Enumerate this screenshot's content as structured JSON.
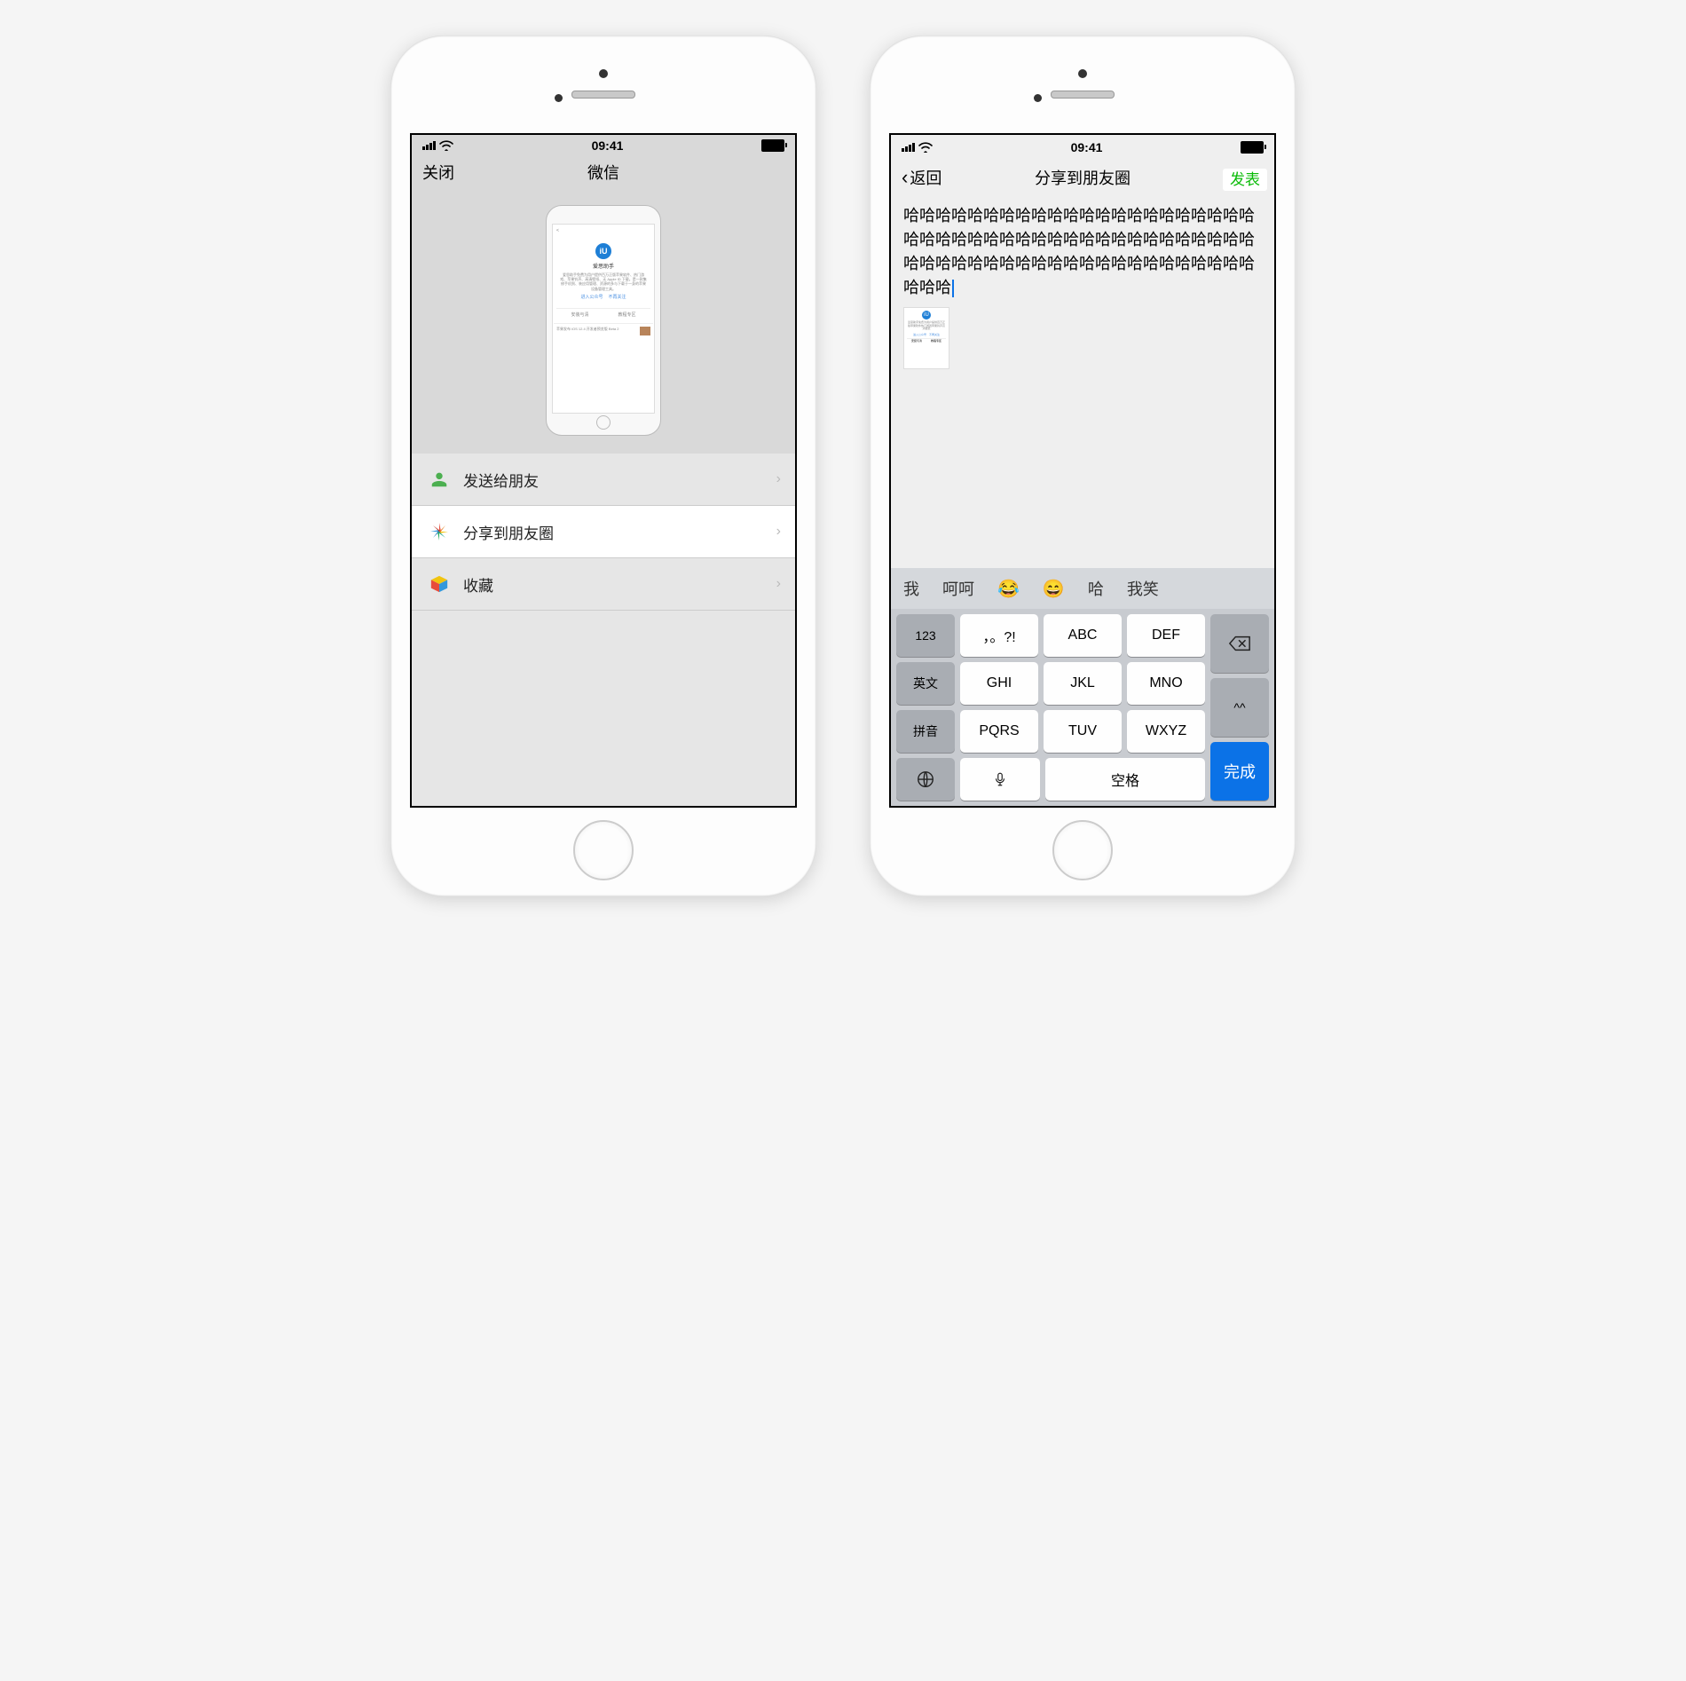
{
  "status_time": "09:41",
  "phone1": {
    "nav_close": "关闭",
    "nav_title": "微信",
    "preview_app": "爱思助手",
    "preview_btn_left": "进入公众号",
    "preview_btn_right": "不再关注",
    "preview_tab_left": "安装与清",
    "preview_tab_right": "教程专区",
    "preview_news": "苹果发布 iOS 12.4 开发者预览版 Beta 2",
    "actions": {
      "send_friend": "发送给朋友",
      "share_moments": "分享到朋友圈",
      "favorite": "收藏"
    }
  },
  "phone2": {
    "nav_back": "返回",
    "nav_title": "分享到朋友圈",
    "nav_publish": "发表",
    "compose_text": "哈哈哈哈哈哈哈哈哈哈哈哈哈哈哈哈哈哈哈哈哈哈哈哈哈哈哈哈哈哈哈哈哈哈哈哈哈哈哈哈哈哈哈哈哈哈哈哈哈哈哈哈哈哈哈哈哈哈哈哈哈哈哈哈哈哈哈哈哈",
    "suggestions": [
      "我",
      "呵呵",
      "😂",
      "😄",
      "哈",
      "我笑"
    ],
    "keyboard": {
      "left": [
        "123",
        "英文",
        "拼音",
        "🌐"
      ],
      "center": [
        [
          "，。?!",
          "ABC",
          "DEF"
        ],
        [
          "GHI",
          "JKL",
          "MNO"
        ],
        [
          "PQRS",
          "TUV",
          "WXYZ"
        ],
        [
          "mic",
          "空格"
        ]
      ],
      "right_backspace": "⌫",
      "right_face": "^^",
      "right_done": "完成"
    }
  }
}
